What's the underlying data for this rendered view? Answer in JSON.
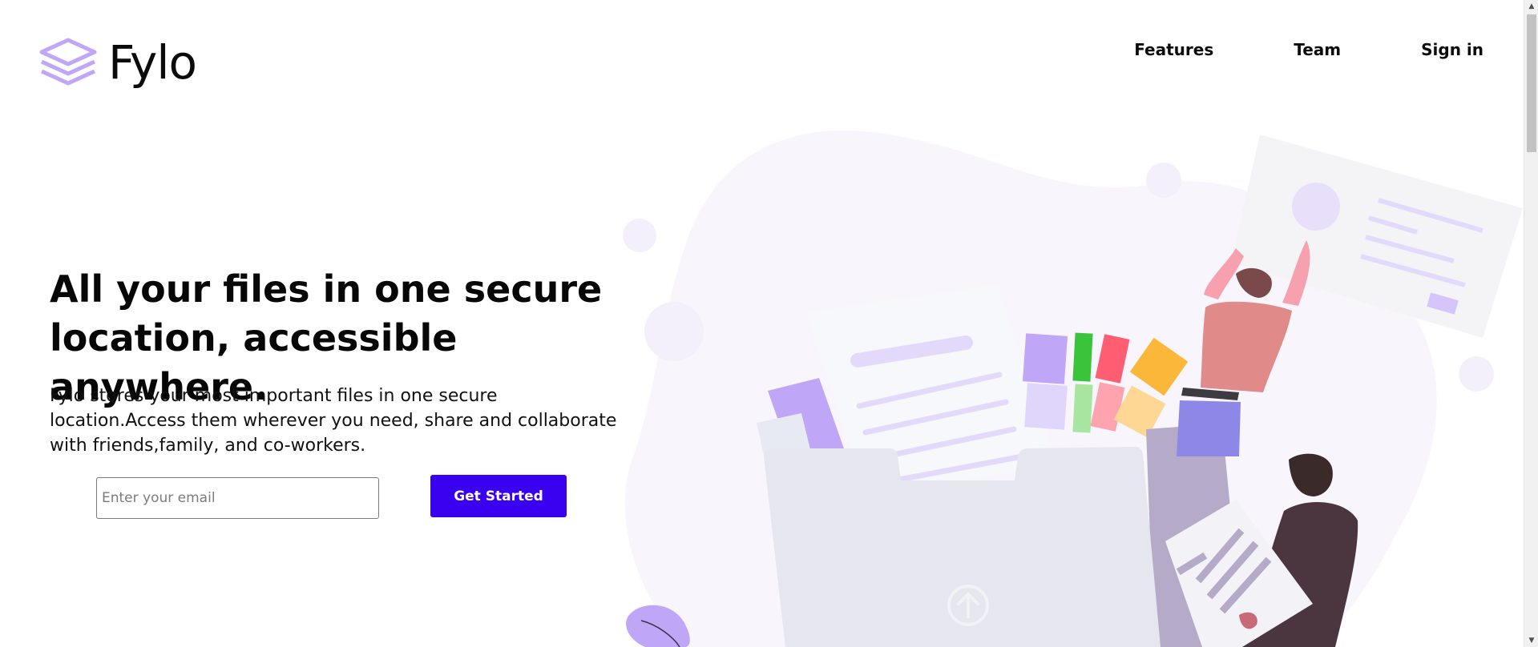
{
  "header": {
    "logo_text": "Fylo",
    "nav": [
      {
        "label": "Features"
      },
      {
        "label": "Team"
      },
      {
        "label": "Sign in"
      }
    ]
  },
  "hero": {
    "title": "All your files in one secure location, accessible anywhere.",
    "description": "Fylo stores your most important files in one secure location.Access them wherever you need, share and collaborate with friends,family, and co-workers.",
    "email_placeholder": "Enter your email",
    "cta_label": "Get Started"
  },
  "icons": {
    "logo": "stacked-layers-icon",
    "upload": "arrow-up-circle-icon",
    "scroll_up": "triangle-up-icon",
    "scroll_down": "triangle-down-icon"
  },
  "colors": {
    "accent": "#3a00f0",
    "logo_purple": "#c3a8f8",
    "blob": "#f8f5fd"
  }
}
